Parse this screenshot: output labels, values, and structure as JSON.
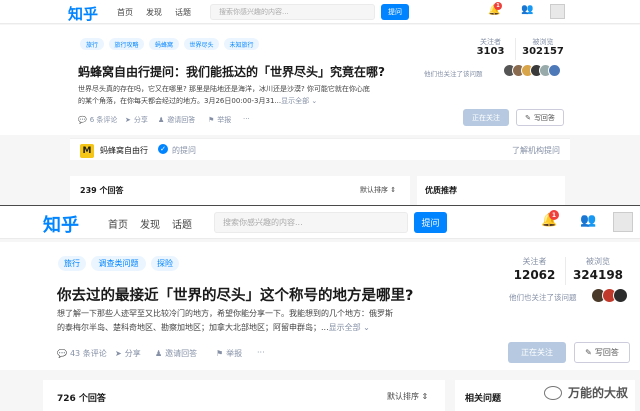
{
  "top": {
    "logo": "知乎",
    "nav": [
      "首页",
      "发现",
      "话题"
    ],
    "search_placeholder": "搜索你感兴趣的内容...",
    "ask_label": "提问",
    "notification_count": "1",
    "tags": [
      "旅行",
      "旅行攻略",
      "蚂蜂窝",
      "世界尽头",
      "未知旅行"
    ],
    "title": "蚂蜂窝自由行提问：我们能抵达的「世界尽头」究竟在哪?",
    "desc_line1": "世界尽头真的存在吗，它又在哪里? 那里是陆地还是海洋，冰川还是沙漠? 你可能它就在你心底",
    "desc_line2": "的某个角落，在你每天都会经过的地方。3月26日00:00-3月31...",
    "desc_more": "显示全部 ⌄",
    "actions": [
      "6 条评论",
      "分享",
      "邀请回答",
      "举报",
      "···"
    ],
    "followers_label": "关注者",
    "followers": "3103",
    "views_label": "被浏览",
    "views": "302157",
    "friends_text": "他们也关注了该问题",
    "follow_label": "正在关注",
    "answer_label": "写回答",
    "asker_name": "蚂蜂窝自由行",
    "asker_suffix": "的提问",
    "asker_link": "了解机构提问",
    "answers_count": "239 个回答",
    "sort_label": "默认排序 ⇕",
    "side_title": "优质推荐"
  },
  "bottom": {
    "logo": "知乎",
    "nav": [
      "首页",
      "发现",
      "话题"
    ],
    "search_placeholder": "搜索你感兴趣的内容...",
    "ask_label": "提问",
    "notification_count": "1",
    "tags": [
      "旅行",
      "调查类问题",
      "探险"
    ],
    "title": "你去过的最接近「世界的尽头」这个称号的地方是哪里?",
    "desc_line1": "想了解一下那些人迹罕至又比较冷门的地方，希望你能分享一下。我能想到的几个地方：俄罗斯",
    "desc_line2": "的泰梅尔半岛、楚科奇地区、勘察加地区；加拿大北部地区；阿留申群岛；...",
    "desc_more": "显示全部 ⌄",
    "actions": [
      "43 条评论",
      "分享",
      "邀请回答",
      "举报",
      "···"
    ],
    "followers_label": "关注者",
    "followers": "12062",
    "views_label": "被浏览",
    "views": "324198",
    "friends_text": "他们也关注了该问题",
    "follow_label": "正在关注",
    "answer_label": "写回答",
    "answers_count": "726 个回答",
    "sort_label": "默认排序 ⇕",
    "side_title": "相关问题"
  },
  "watermark": "万能的大叔",
  "colors": {
    "accent": "#0084ff",
    "tag_bg": "#ebf5ff",
    "badge": "#f1403c"
  }
}
